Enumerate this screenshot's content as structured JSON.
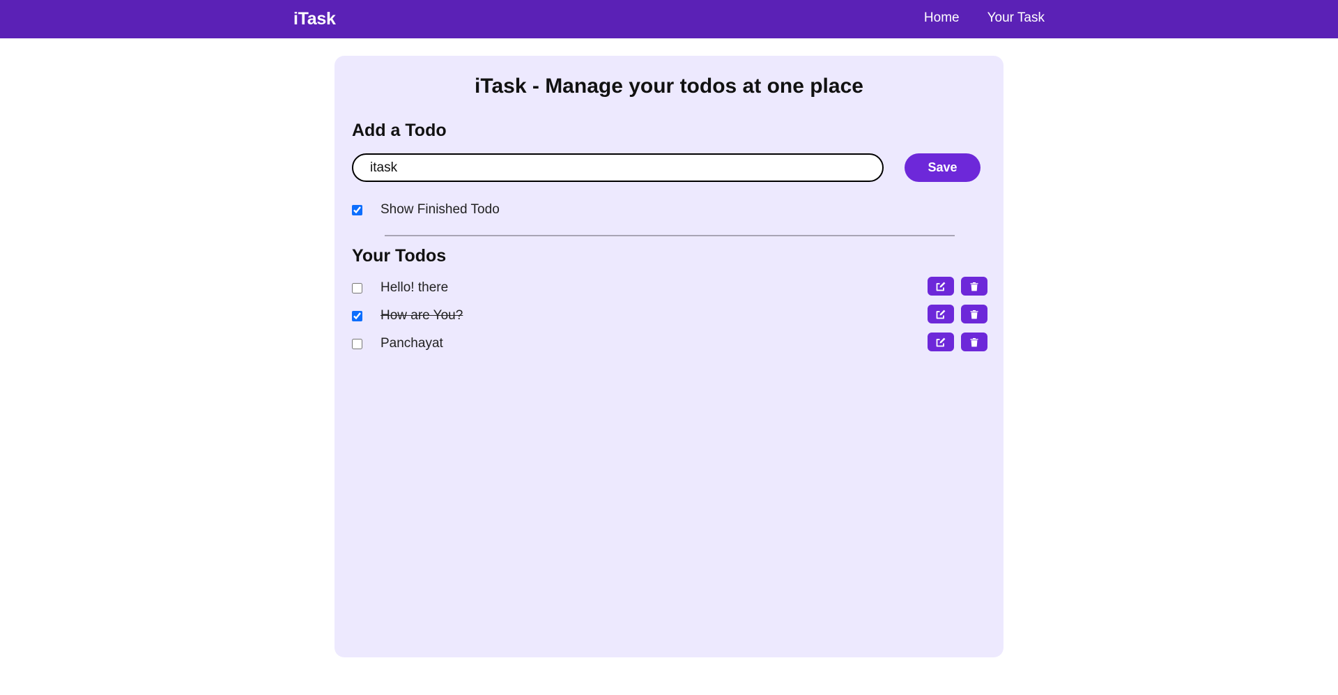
{
  "navbar": {
    "brand": "iTask",
    "links": [
      {
        "label": "Home"
      },
      {
        "label": "Your Task"
      }
    ]
  },
  "main": {
    "title": "iTask - Manage your todos at one place",
    "add_heading": "Add a Todo",
    "input_value": "itask",
    "save_label": "Save",
    "show_finished_label": "Show Finished Todo",
    "show_finished_checked": true,
    "todos_heading": "Your Todos",
    "todos": [
      {
        "text": "Hello! there",
        "completed": false
      },
      {
        "text": "How are You?",
        "completed": true
      },
      {
        "text": "Panchayat",
        "completed": false
      }
    ]
  },
  "colors": {
    "navbar": "#5b21b6",
    "card": "#ede9fe",
    "accent": "#6d28d9"
  },
  "icons": {
    "edit": "edit-icon",
    "delete": "trash-icon"
  }
}
